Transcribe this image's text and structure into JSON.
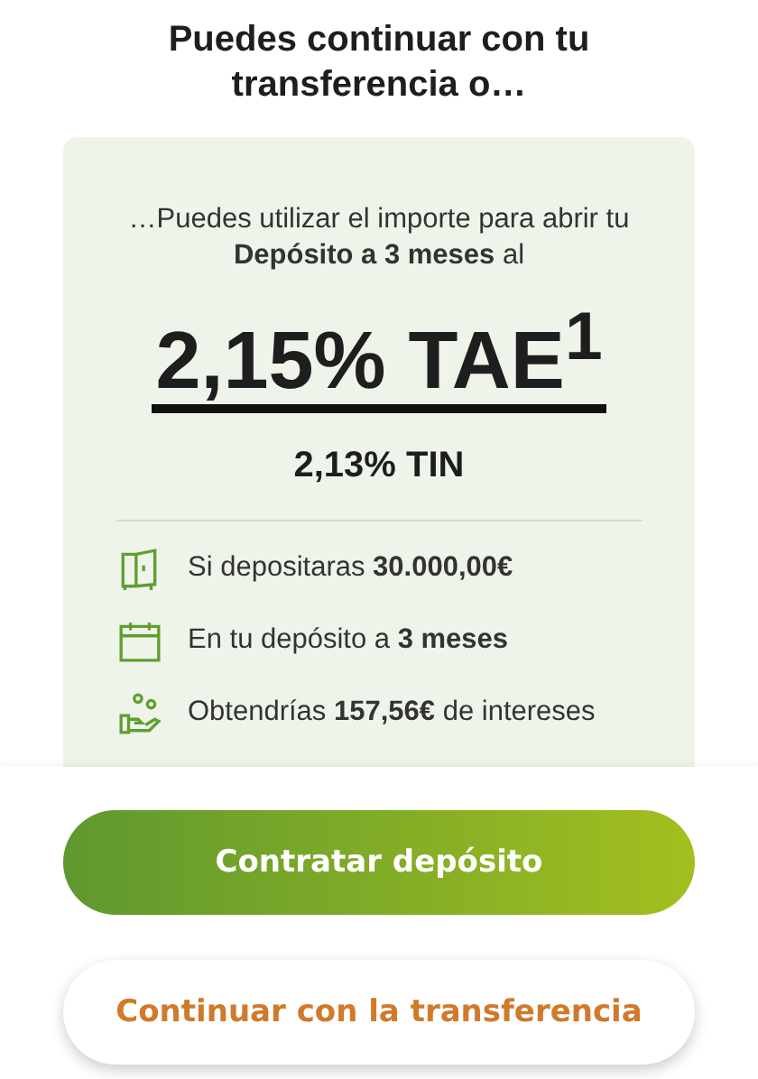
{
  "title": "Puedes continuar con tu transferencia o…",
  "card": {
    "intro": "…Puedes utilizar el importe para abrir tu **Depósito a 3 meses** al",
    "rate": "2,15% TAE$^{1}$",
    "tin": "2,13% TIN",
    "features": [
      {
        "kind": "safe",
        "text": "Si depositaras **30.000,00€**"
      },
      {
        "kind": "calendar",
        "text": "En tu depósito a **3 meses**"
      },
      {
        "kind": "hand-coins",
        "text": "Obtendrías **157,56€** de intereses"
      }
    ]
  },
  "buttons": [
    {
      "kind": "primary",
      "label": "Contratar depósito"
    },
    {
      "kind": "secondary",
      "label": "Continuar con la transferencia"
    }
  ]
}
